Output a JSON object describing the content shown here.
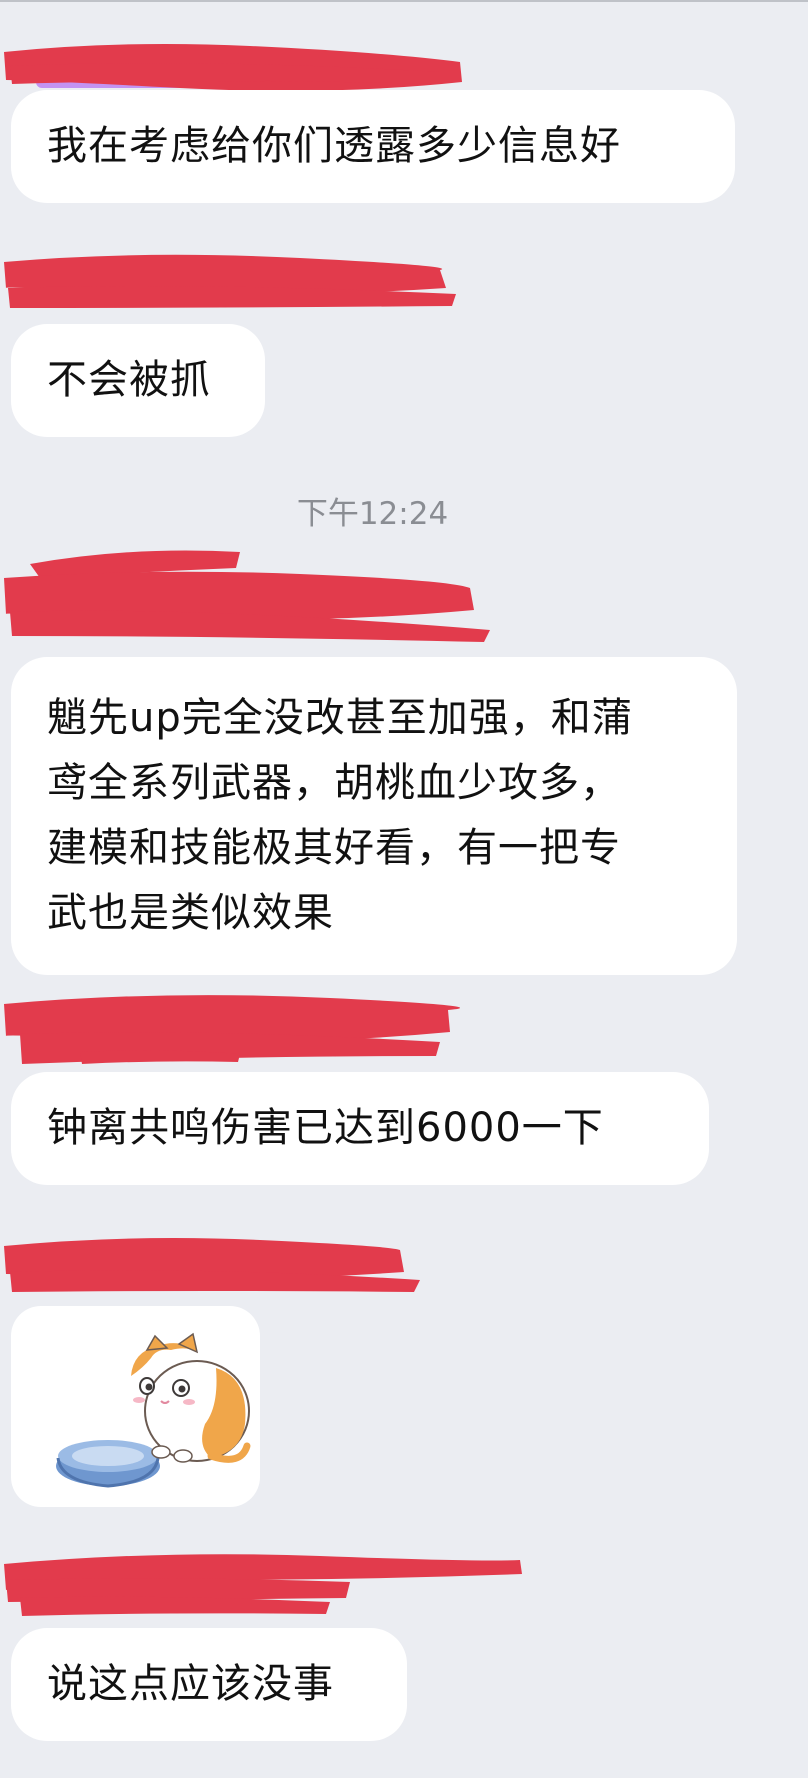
{
  "messages": [
    {
      "type": "text",
      "lines": [
        "我在考虑给你们透露多少信息好"
      ]
    },
    {
      "type": "text",
      "lines": [
        "不会被抓"
      ]
    },
    {
      "type": "timestamp",
      "text": "下午12:24"
    },
    {
      "type": "text",
      "lines": [
        "魈先up完全没改甚至加强，和蒲",
        "鸢全系列武器，胡桃血少攻多，",
        "建模和技能极其好看，有一把专",
        "武也是类似效果"
      ]
    },
    {
      "type": "text",
      "lines": [
        "钟离共鸣伤害已达到6000一下"
      ]
    },
    {
      "type": "sticker",
      "icon": "cat-with-bowl-sticker"
    },
    {
      "type": "text",
      "lines": [
        "说这点应该没事"
      ]
    }
  ],
  "colors": {
    "background": "#ebedf2",
    "bubble": "#ffffff",
    "redaction": "#e23b4c",
    "text": "#111111",
    "timestamp": "#8a8d93"
  }
}
